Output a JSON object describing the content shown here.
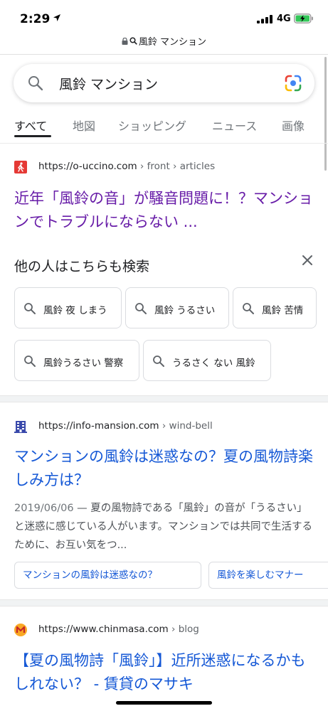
{
  "status_bar": {
    "time": "2:29",
    "network": "4G"
  },
  "url_bar": {
    "text": "風鈴 マンション"
  },
  "search": {
    "query": "風鈴 マンション"
  },
  "tabs": [
    {
      "label": "すべて",
      "active": true
    },
    {
      "label": "地図",
      "active": false
    },
    {
      "label": "ショッピング",
      "active": false
    },
    {
      "label": "ニュース",
      "active": false
    },
    {
      "label": "画像",
      "active": false
    }
  ],
  "results": [
    {
      "url": "https://o-uccino.com",
      "crumb": " › front › articles",
      "title": "近年「風鈴の音」が騒音問題に！？マンションでトラブルにならない ...",
      "visited": true,
      "favicon_color": "#e53935"
    },
    {
      "url": "https://info-mansion.com",
      "crumb": " › wind-bell",
      "title": "マンションの風鈴は迷惑なの？夏の風物詩楽しみ方は？",
      "visited": false,
      "date": "2019/06/06",
      "snippet": " — 夏の風物詩である「風鈴」の音が「うるさい」と迷惑に感じている人がいます。マンションでは共同で生活するために、お互い気をつ...",
      "sitelinks": [
        "マンションの風鈴は迷惑なの？",
        "風鈴を楽しむマナー"
      ],
      "favicon_color": "#3949ab"
    },
    {
      "url": "https://www.chinmasa.com",
      "crumb": " › blog",
      "title": "【夏の風物詩「風鈴」】近所迷惑になるかもしれない？ - 賃貸のマサキ",
      "visited": false,
      "favicon_color": "#f9a825"
    }
  ],
  "people_also_search": {
    "title": "他の人はこちらも検索",
    "chips": [
      "風鈴 夜 しまう",
      "風鈴 うるさい",
      "風鈴 苦情",
      "風鈴うるさい 警察",
      "うるさく ない 風鈴"
    ]
  },
  "colors": {
    "visited_link": "#681da8",
    "link": "#1558d6",
    "text": "#202124",
    "secondary": "#70757a"
  },
  "icons": [
    "location-arrow-icon",
    "signal-icon",
    "battery-charging-icon",
    "lock-icon",
    "search-icon",
    "google-lens-icon",
    "close-icon"
  ]
}
